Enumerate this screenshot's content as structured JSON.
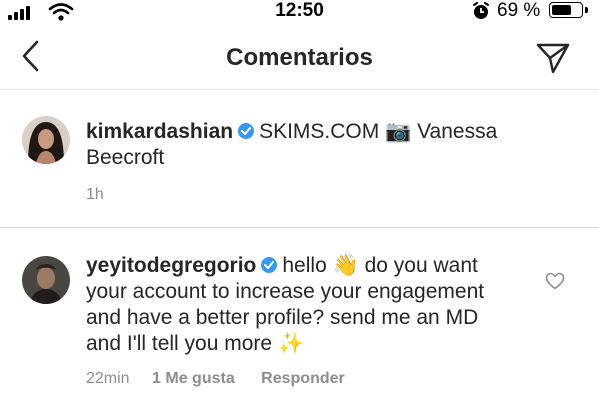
{
  "status_bar": {
    "time": "12:50",
    "battery_percent": "69 %",
    "battery_level": 0.69
  },
  "nav": {
    "title": "Comentarios",
    "back_icon": "chevron-left-icon",
    "share_icon": "paper-plane-icon"
  },
  "caption": {
    "username": "kimkardashian",
    "verified": true,
    "text_part1": "SKIMS.COM",
    "camera_emoji": "📷",
    "text_part2": "Vanessa Beecroft",
    "time": "1h"
  },
  "comment": {
    "username": "yeyitodegregorio",
    "verified": true,
    "text_part1": "hello",
    "wave_emoji": "👋",
    "text_part2": "do you want your account to increase your engagement and have a better profile? send me an MD and I'll tell you more",
    "sparkles_emoji": "✨",
    "time": "22min",
    "likes": "1 Me gusta",
    "reply": "Responder"
  },
  "colors": {
    "text": "#262626",
    "secondary": "#8e8e8e",
    "verified": "#3897f0",
    "divider": "#dbdbdb"
  }
}
